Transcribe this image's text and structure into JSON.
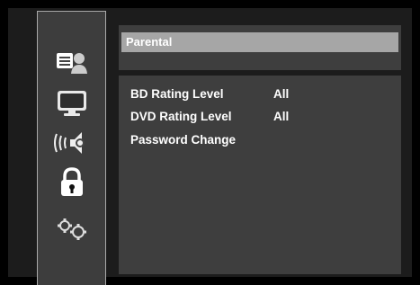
{
  "panel": {
    "title": "Parental",
    "items": [
      {
        "label": "BD Rating Level",
        "value": "All"
      },
      {
        "label": "DVD Rating Level",
        "value": "All"
      },
      {
        "label": "Password Change",
        "value": ""
      }
    ]
  },
  "sidebar": {
    "icons": [
      "disc-person-icon",
      "monitor-icon",
      "speaker-icon",
      "lock-icon",
      "gears-icon"
    ],
    "selected": "lock-icon"
  }
}
